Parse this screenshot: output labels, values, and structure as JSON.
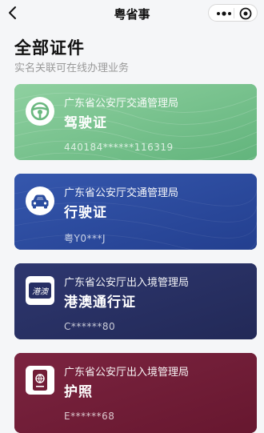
{
  "nav": {
    "title": "粤省事",
    "back_icon": "chevron-left-icon",
    "more_icon": "more-dots-icon",
    "close_icon": "target-close-icon"
  },
  "header": {
    "title": "全部证件",
    "subtitle": "实名关联可在线办理业务"
  },
  "cards": [
    {
      "authority": "广东省公安厅交通管理局",
      "name": "驾驶证",
      "number": "440184******116319",
      "icon": "steering-wheel-icon",
      "color": "#75c18c"
    },
    {
      "authority": "广东省公安厅交通管理局",
      "name": "行驶证",
      "number": "粤Y0***J",
      "icon": "car-icon",
      "color": "#2a4c9f"
    },
    {
      "authority": "广东省公安厅出入境管理局",
      "name": "港澳通行证",
      "number": "C******80",
      "icon": "hk-macau-permit-icon",
      "icon_text": "港澳",
      "color": "#272f64"
    },
    {
      "authority": "广东省公安厅出入境管理局",
      "name": "护照",
      "number": "E******68",
      "icon": "passport-icon",
      "color": "#711c36"
    }
  ]
}
